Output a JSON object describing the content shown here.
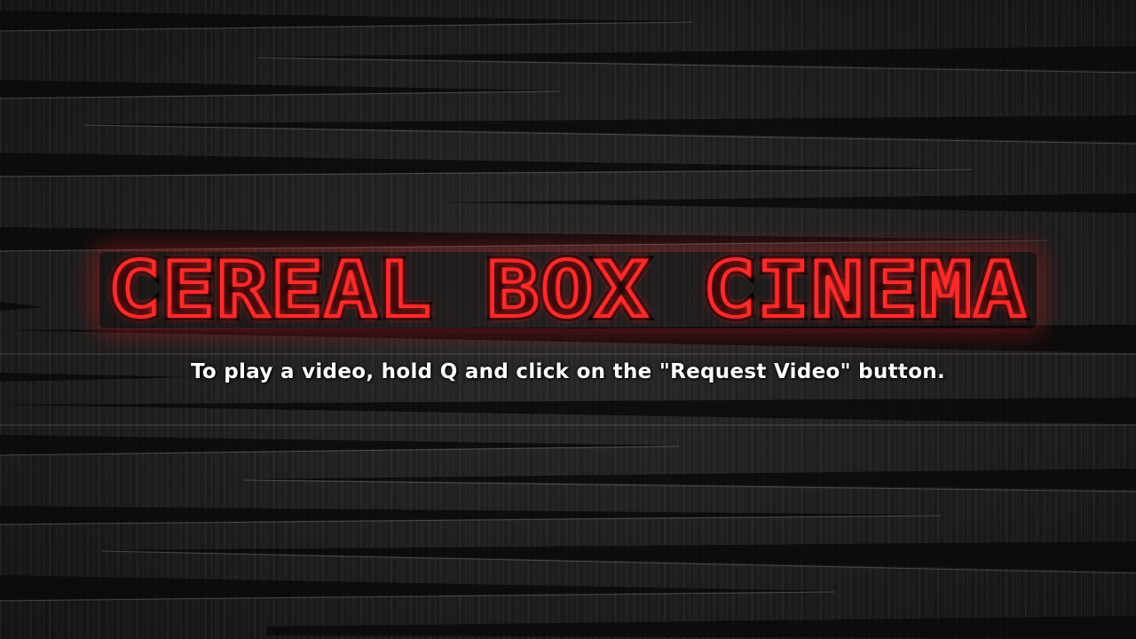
{
  "logo": {
    "title": "CEREAL BOX CINEMA",
    "color": "#ff2a2a",
    "glow_color": "#ff1e1e"
  },
  "instructions": {
    "text": "To play a video, hold Q and click on the \"Request Video\" button."
  }
}
